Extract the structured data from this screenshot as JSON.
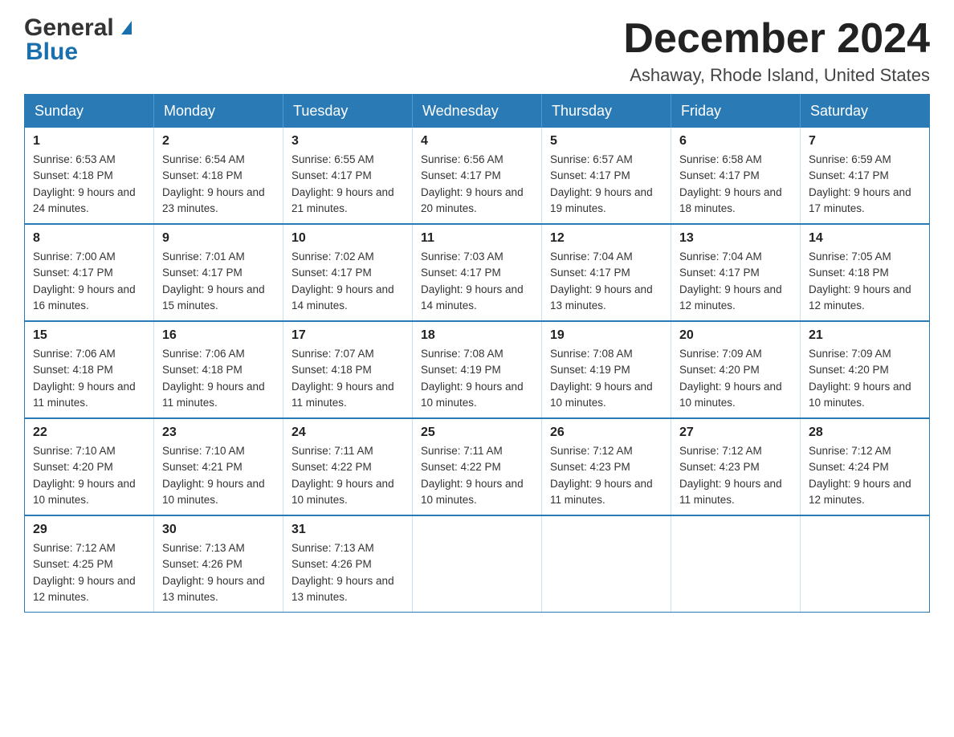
{
  "header": {
    "logo_general": "General",
    "logo_blue": "Blue",
    "month_title": "December 2024",
    "location": "Ashaway, Rhode Island, United States"
  },
  "weekdays": [
    "Sunday",
    "Monday",
    "Tuesday",
    "Wednesday",
    "Thursday",
    "Friday",
    "Saturday"
  ],
  "weeks": [
    [
      {
        "day": "1",
        "sunrise": "Sunrise: 6:53 AM",
        "sunset": "Sunset: 4:18 PM",
        "daylight": "Daylight: 9 hours and 24 minutes."
      },
      {
        "day": "2",
        "sunrise": "Sunrise: 6:54 AM",
        "sunset": "Sunset: 4:18 PM",
        "daylight": "Daylight: 9 hours and 23 minutes."
      },
      {
        "day": "3",
        "sunrise": "Sunrise: 6:55 AM",
        "sunset": "Sunset: 4:17 PM",
        "daylight": "Daylight: 9 hours and 21 minutes."
      },
      {
        "day": "4",
        "sunrise": "Sunrise: 6:56 AM",
        "sunset": "Sunset: 4:17 PM",
        "daylight": "Daylight: 9 hours and 20 minutes."
      },
      {
        "day": "5",
        "sunrise": "Sunrise: 6:57 AM",
        "sunset": "Sunset: 4:17 PM",
        "daylight": "Daylight: 9 hours and 19 minutes."
      },
      {
        "day": "6",
        "sunrise": "Sunrise: 6:58 AM",
        "sunset": "Sunset: 4:17 PM",
        "daylight": "Daylight: 9 hours and 18 minutes."
      },
      {
        "day": "7",
        "sunrise": "Sunrise: 6:59 AM",
        "sunset": "Sunset: 4:17 PM",
        "daylight": "Daylight: 9 hours and 17 minutes."
      }
    ],
    [
      {
        "day": "8",
        "sunrise": "Sunrise: 7:00 AM",
        "sunset": "Sunset: 4:17 PM",
        "daylight": "Daylight: 9 hours and 16 minutes."
      },
      {
        "day": "9",
        "sunrise": "Sunrise: 7:01 AM",
        "sunset": "Sunset: 4:17 PM",
        "daylight": "Daylight: 9 hours and 15 minutes."
      },
      {
        "day": "10",
        "sunrise": "Sunrise: 7:02 AM",
        "sunset": "Sunset: 4:17 PM",
        "daylight": "Daylight: 9 hours and 14 minutes."
      },
      {
        "day": "11",
        "sunrise": "Sunrise: 7:03 AM",
        "sunset": "Sunset: 4:17 PM",
        "daylight": "Daylight: 9 hours and 14 minutes."
      },
      {
        "day": "12",
        "sunrise": "Sunrise: 7:04 AM",
        "sunset": "Sunset: 4:17 PM",
        "daylight": "Daylight: 9 hours and 13 minutes."
      },
      {
        "day": "13",
        "sunrise": "Sunrise: 7:04 AM",
        "sunset": "Sunset: 4:17 PM",
        "daylight": "Daylight: 9 hours and 12 minutes."
      },
      {
        "day": "14",
        "sunrise": "Sunrise: 7:05 AM",
        "sunset": "Sunset: 4:18 PM",
        "daylight": "Daylight: 9 hours and 12 minutes."
      }
    ],
    [
      {
        "day": "15",
        "sunrise": "Sunrise: 7:06 AM",
        "sunset": "Sunset: 4:18 PM",
        "daylight": "Daylight: 9 hours and 11 minutes."
      },
      {
        "day": "16",
        "sunrise": "Sunrise: 7:06 AM",
        "sunset": "Sunset: 4:18 PM",
        "daylight": "Daylight: 9 hours and 11 minutes."
      },
      {
        "day": "17",
        "sunrise": "Sunrise: 7:07 AM",
        "sunset": "Sunset: 4:18 PM",
        "daylight": "Daylight: 9 hours and 11 minutes."
      },
      {
        "day": "18",
        "sunrise": "Sunrise: 7:08 AM",
        "sunset": "Sunset: 4:19 PM",
        "daylight": "Daylight: 9 hours and 10 minutes."
      },
      {
        "day": "19",
        "sunrise": "Sunrise: 7:08 AM",
        "sunset": "Sunset: 4:19 PM",
        "daylight": "Daylight: 9 hours and 10 minutes."
      },
      {
        "day": "20",
        "sunrise": "Sunrise: 7:09 AM",
        "sunset": "Sunset: 4:20 PM",
        "daylight": "Daylight: 9 hours and 10 minutes."
      },
      {
        "day": "21",
        "sunrise": "Sunrise: 7:09 AM",
        "sunset": "Sunset: 4:20 PM",
        "daylight": "Daylight: 9 hours and 10 minutes."
      }
    ],
    [
      {
        "day": "22",
        "sunrise": "Sunrise: 7:10 AM",
        "sunset": "Sunset: 4:20 PM",
        "daylight": "Daylight: 9 hours and 10 minutes."
      },
      {
        "day": "23",
        "sunrise": "Sunrise: 7:10 AM",
        "sunset": "Sunset: 4:21 PM",
        "daylight": "Daylight: 9 hours and 10 minutes."
      },
      {
        "day": "24",
        "sunrise": "Sunrise: 7:11 AM",
        "sunset": "Sunset: 4:22 PM",
        "daylight": "Daylight: 9 hours and 10 minutes."
      },
      {
        "day": "25",
        "sunrise": "Sunrise: 7:11 AM",
        "sunset": "Sunset: 4:22 PM",
        "daylight": "Daylight: 9 hours and 10 minutes."
      },
      {
        "day": "26",
        "sunrise": "Sunrise: 7:12 AM",
        "sunset": "Sunset: 4:23 PM",
        "daylight": "Daylight: 9 hours and 11 minutes."
      },
      {
        "day": "27",
        "sunrise": "Sunrise: 7:12 AM",
        "sunset": "Sunset: 4:23 PM",
        "daylight": "Daylight: 9 hours and 11 minutes."
      },
      {
        "day": "28",
        "sunrise": "Sunrise: 7:12 AM",
        "sunset": "Sunset: 4:24 PM",
        "daylight": "Daylight: 9 hours and 12 minutes."
      }
    ],
    [
      {
        "day": "29",
        "sunrise": "Sunrise: 7:12 AM",
        "sunset": "Sunset: 4:25 PM",
        "daylight": "Daylight: 9 hours and 12 minutes."
      },
      {
        "day": "30",
        "sunrise": "Sunrise: 7:13 AM",
        "sunset": "Sunset: 4:26 PM",
        "daylight": "Daylight: 9 hours and 13 minutes."
      },
      {
        "day": "31",
        "sunrise": "Sunrise: 7:13 AM",
        "sunset": "Sunset: 4:26 PM",
        "daylight": "Daylight: 9 hours and 13 minutes."
      },
      null,
      null,
      null,
      null
    ]
  ]
}
